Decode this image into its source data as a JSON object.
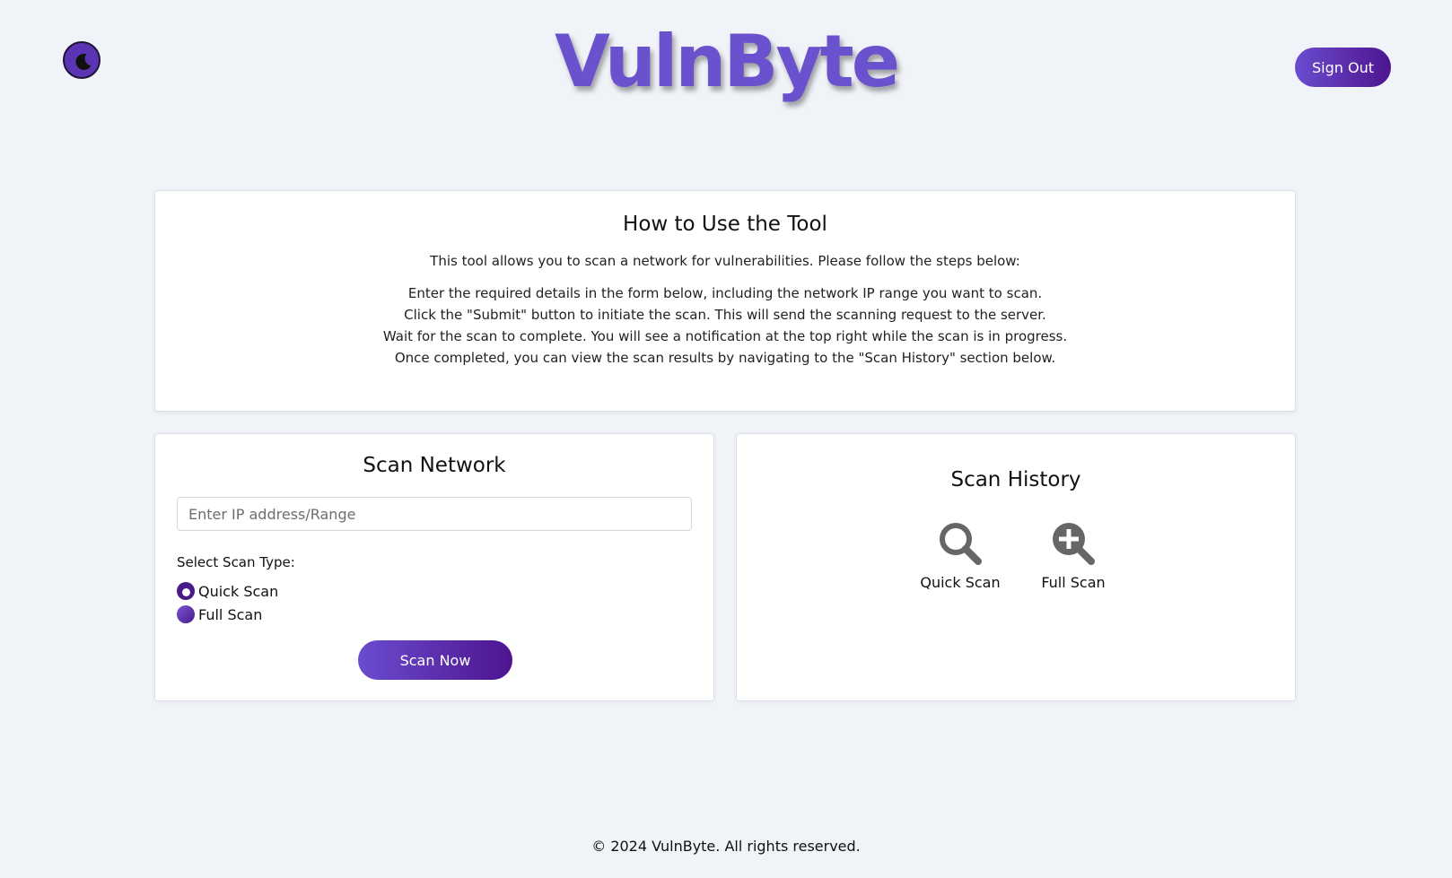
{
  "header": {
    "brand": "VulnByte",
    "theme_toggle_icon": "moon-icon",
    "sign_out_label": "Sign Out"
  },
  "instructions": {
    "title": "How to Use the Tool",
    "intro": "This tool allows you to scan a network for vulnerabilities. Please follow the steps below:",
    "steps": [
      "Enter the required details in the form below, including the network IP range you want to scan.",
      "Click the \"Submit\" button to initiate the scan. This will send the scanning request to the server.",
      "Wait for the scan to complete. You will see a notification at the top right while the scan is in progress.",
      "Once completed, you can view the scan results by navigating to the \"Scan History\" section below."
    ]
  },
  "scan_network": {
    "title": "Scan Network",
    "ip_placeholder": "Enter IP address/Range",
    "ip_value": "",
    "scan_type_label": "Select Scan Type:",
    "options": [
      {
        "label": "Quick Scan",
        "selected": true
      },
      {
        "label": "Full Scan",
        "selected": false
      }
    ],
    "submit_label": "Scan Now"
  },
  "scan_history": {
    "title": "Scan History",
    "items": [
      {
        "label": "Quick Scan",
        "icon": "magnifier-icon"
      },
      {
        "label": "Full Scan",
        "icon": "magnifier-plus-icon"
      }
    ]
  },
  "footer": {
    "text": "© 2024 VulnByte. All rights reserved."
  },
  "colors": {
    "accent": "#6a52cf",
    "accent_dark": "#4e148f",
    "background": "#f0f3f8",
    "card": "#ffffff"
  }
}
